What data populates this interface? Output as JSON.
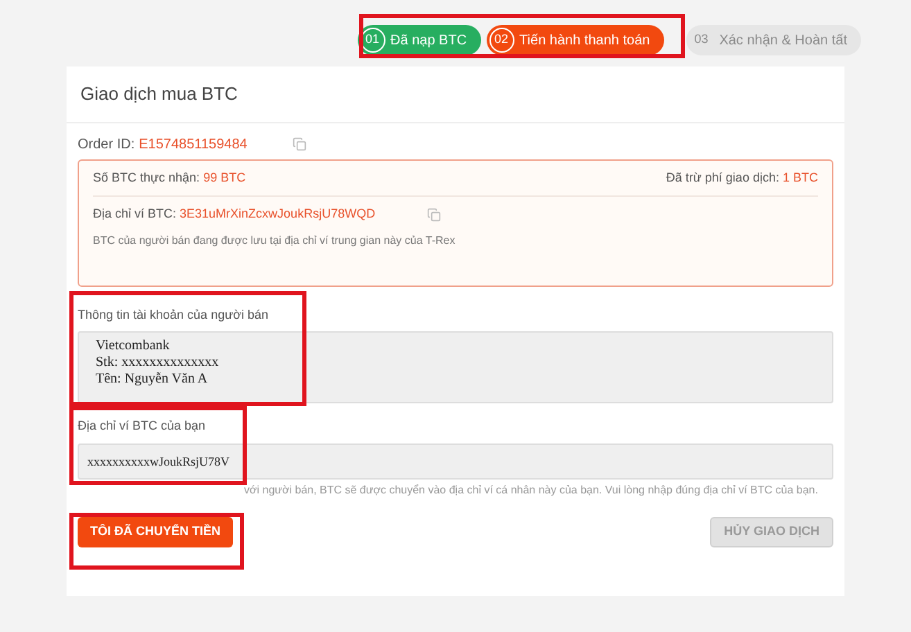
{
  "steps": [
    {
      "number": "01",
      "label": "Đã nạp BTC",
      "kind": "done"
    },
    {
      "number": "02",
      "label": "Tiến hành thanh toán",
      "kind": "active"
    },
    {
      "number": "03",
      "label": "Xác nhận & Hoàn tất",
      "kind": "pending"
    }
  ],
  "card": {
    "title": "Giao dịch mua BTC",
    "order": {
      "label": "Order ID:",
      "value": "E1574851159484"
    },
    "info_box": {
      "received_label": "Số BTC thực nhận:",
      "received_value": "99 BTC",
      "fee_label": "Đã trừ phí giao dịch:",
      "fee_value": "1 BTC",
      "address_label": "Địa chỉ ví BTC:",
      "address_value": "3E31uMrXinZcxwJoukRsjU78WQD",
      "note": "BTC của người bán đang được lưu tại địa chỉ ví trung gian này của T-Rex"
    },
    "seller_account": {
      "label": "Thông tin tài khoản của người bán",
      "lines": [
        "Vietcombank",
        "Stk: xxxxxxxxxxxxxx",
        "Tên: Nguyễn Văn A"
      ]
    },
    "wallet_field": {
      "label": "Địa chỉ ví BTC của bạn",
      "value": "xxxxxxxxxxwJoukRsjU78V",
      "hint": "với người bán, BTC sẽ được chuyển vào địa chỉ ví cá nhân này của bạn. Vui lòng nhập đúng địa chỉ ví BTC của bạn."
    },
    "buttons": [
      {
        "label": "TÔI ĐÃ CHUYỂN TIỀN",
        "kind": "primary"
      },
      {
        "label": "HỦY GIAO DỊCH",
        "kind": "disabled"
      }
    ]
  }
}
